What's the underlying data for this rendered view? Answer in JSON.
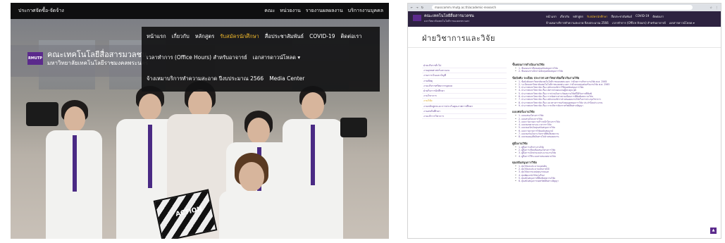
{
  "left": {
    "topbar": {
      "brandline": "ประกาศจัดซื้อ-จัดจ้าง",
      "links": [
        "คณะ",
        "หน่วยงาน",
        "รายงานผลผลงาน",
        "บริการงานบุคคล"
      ]
    },
    "logo": {
      "mark": "RMUTP",
      "line1": "คณะเทคโนโลยีสื่อสารมวลชน",
      "line2": "มหาวิทยาลัยเทคโนโลยีราชมงคลพระนคร"
    },
    "menu": {
      "row1": [
        "หน้าแรก",
        "เกี่ยวกับ",
        "หลักสูตร",
        "รับสมัครนักศึกษา",
        "สื่อประชาสัมพันธ์",
        "COVID-19",
        "ติดต่อเรา"
      ],
      "row1_active_index": 3,
      "row2_item": "เวลาทำการ (Office Hours) สำหรับอาจารย์",
      "row2_download": "เอกสารดาวน์โหลด",
      "row2_arrow": "▾",
      "row3_item": "จ้างเหมาบริการทำความสะอาด ปีงบประมาณ 2566",
      "row3_media": "Media Center"
    },
    "clapper_label": "ACTION"
  },
  "right": {
    "browser": {
      "back": "←",
      "forward": "→",
      "reload": "↻",
      "url": "masscomm.rmutp.ac.th/academic-research",
      "ext": [
        "☆",
        "⋮"
      ]
    },
    "site": {
      "logo_mark": "",
      "title": "คณะเทคโนโลยีสื่อสารมวลชน",
      "subtitle": "มหาวิทยาลัยเทคโนโลยีราชมงคลพระนคร",
      "nav1": [
        "หน้าแรก",
        "เกี่ยวกับ",
        "หลักสูตร",
        "รับสมัครนักศึกษา",
        "สื่อประชาสัมพันธ์",
        "COVID-19",
        "ติดต่อเรา"
      ],
      "nav1_active_index": 3,
      "nav2": [
        "จ้างเหมาบริการทำความสะอาด ปีงบประมาณ 2566",
        "เวลาทำการ (Office Hours) สำหรับอาจารย์",
        "เอกสารดาวน์โหลด ▾"
      ]
    },
    "heading": "ฝ่ายวิชาการและวิจัย",
    "sidebar": [
      "ฝ่ายบริหารทั่วไป",
      "งานยุทธศาสตร์และแผน",
      "งานการเงินและบัญชี",
      "งานพัสดุ",
      "งานบริหารทรัพยากรบุคคล",
      "ฝ่ายกิจการนักศึกษา",
      "งานวิชาการ",
      "งานวิจัย",
      "งานหลักสูตรและการประกันคุณภาพการศึกษา",
      "งานสหกิจศึกษา",
      "งานบริการวิชาการ"
    ],
    "sidebar_active_index": 7,
    "sections": [
      {
        "title": "ขั้นตอนการดำเนินงานวิจัย",
        "items": [
          "1. ขั้นตอนการยื่นขอทุนสนับสนุนการวิจัย",
          "2. ขั้นตอนการเบิกจ่ายเงินทุนสนับสนุนการวิจัย"
        ]
      },
      {
        "title": "ข้อบังคับ ระเบียบ ประกาศ มหาวิทยาลัยเกี่ยวกับงานวิจัย",
        "items": [
          "1. ข้อบังคับมหาวิทยาลัยเทคโนโลยีราชมงคลพระนคร ว่าด้วยการบริหารงานวิจัย พ.ศ. 2565",
          "2. ระเบียบมหาวิทยาลัยเทคโนโลยีราชมงคลพระนคร ว่าด้วยกองทุนส่งเสริมงานวิจัย พ.ศ. 2565",
          "3. ประกาศมหาวิทยาลัย เรื่อง หลักเกณฑ์การให้ทุนสนับสนุนการวิจัย",
          "4. ประกาศมหาวิทยาลัย เรื่อง อัตราค่าตอบแทนผู้ทรงคุณวุฒิ",
          "5. ประกาศมหาวิทยาลัย เรื่อง การจ่ายเงินรางวัลผลงานวิจัยที่ได้รับการตีพิมพ์",
          "6. ประกาศมหาวิทยาลัย เรื่อง การจัดสรรค่าธรรมเนียมการตีพิมพ์บทความวิจัย",
          "7. ประกาศมหาวิทยาลัย เรื่อง หลักเกณฑ์การนำเสนอผลงานวิจัยในการประชุมวิชาการ",
          "8. ประกาศมหาวิทยาลัย เรื่อง แนวทางการขอรับทุนอุดหนุนการวิจัย ประจำปีงบประมาณ",
          "9. ประกาศมหาวิทยาลัย เรื่อง การบริหารจัดการทรัพย์สินทางปัญญา"
        ]
      },
      {
        "title": "แบบฟอร์มงานวิจัย",
        "items": [
          "1. แบบเสนอโครงการวิจัย",
          "2. แบบสรุปโครงการวิจัย",
          "3. แบบรายงานความก้าวหน้าโครงการวิจัย",
          "4. แบบขอขยายระยะเวลาการวิจัย",
          "5. แบบขอเบิกเงินทุนสนับสนุนการวิจัย",
          "6. แบบรายงานการวิจัยฉบับสมบูรณ์",
          "7. แบบขอรับเงินรางวัลการตีพิมพ์บทความ",
          "8. แบบขออนุมัติเดินทางไปนำเสนอผลงาน"
        ]
      },
      {
        "title": "คู่มืองานวิจัย",
        "items": [
          "1. คู่มือการบริหารงานวิจัย",
          "2. คู่มือการเขียนข้อเสนอโครงการวิจัย",
          "3. คู่มือการเบิกจ่ายงบประมาณงานวิจัย",
          "4. คู่มือการใช้ระบบสารสนเทศงานวิจัย"
        ]
      },
      {
        "title": "ทุนสนับสนุนการวิจัย",
        "items": [
          "1. ทุนวิจัยงบประมาณแผ่นดิน",
          "2. ทุนวิจัยงบประมาณเงินรายได้",
          "3. ทุนวิจัยจากแหล่งทุนภายนอก",
          "4. ทุนพัฒนานักวิจัยรุ่นใหม่",
          "5. ทุนสนับสนุนการตีพิมพ์บทความวิจัย",
          "6. ทุนสนับสนุนการจดทรัพย์สินทางปัญญา"
        ]
      }
    ],
    "back_to_top": "▲"
  }
}
